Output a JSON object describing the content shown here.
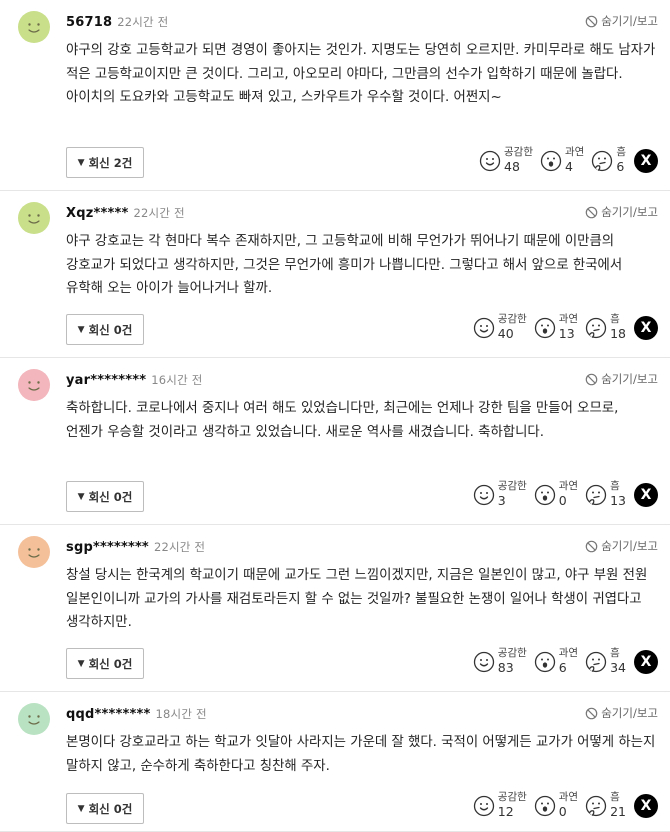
{
  "ui": {
    "hide_label": "숨기기/보고",
    "reply_suffix": "회신",
    "react_empathy": "공감한",
    "react_surprise": "과연",
    "react_hmm": "흠",
    "x_label": "X"
  },
  "comments": [
    {
      "user": "56718",
      "time": "22시간 전",
      "avatar_color": "#c9df8a",
      "body": "야구의 강호 고등학교가 되면 경영이 좋아지는 것인가. 지명도는 당연히 오르지만. 카미무라로 해도 남자가 적은 고등학교이지만 큰 것이다. 그리고, 아오모리 야마다, 그만큼의 선수가 입학하기 때문에 놀랍다. 아이치의 도요카와 고등학교도 빠져 있고, 스카우트가 우수할 것이다. 어쩐지~",
      "reply_label": "회신 2건",
      "empathy": "48",
      "surprise": "4",
      "hmm": "6"
    },
    {
      "user": "Xqz*****",
      "time": "22시간 전",
      "avatar_color": "#c9df8a",
      "body": "야구 강호교는 각 현마다 복수 존재하지만, 그 고등학교에 비해 무언가가 뛰어나기 때문에 이만큼의 강호교가 되었다고 생각하지만, 그것은 무언가에 흥미가 나쁩니다만. 그렇다고 해서 앞으로 한국에서 유학해 오는 아이가 늘어나거나 할까.",
      "reply_label": "회신 0건",
      "empathy": "40",
      "surprise": "13",
      "hmm": "18"
    },
    {
      "user": "yar********",
      "time": "16시간 전",
      "avatar_color": "#f2b6bc",
      "body": "축하합니다. 코로나에서 중지나 여러 해도 있었습니다만, 최근에는 언제나 강한 팀을 만들어 오므로, 언젠가 우승할 것이라고 생각하고 있었습니다. 새로운 역사를 새겼습니다. 축하합니다.",
      "reply_label": "회신 0건",
      "empathy": "3",
      "surprise": "0",
      "hmm": "13"
    },
    {
      "user": "sgp********",
      "time": "22시간 전",
      "avatar_color": "#f4c09a",
      "body": "창설 당시는 한국계의 학교이기 때문에 교가도 그런 느낌이겠지만, 지금은 일본인이 많고, 야구 부원 전원 일본인이니까 교가의 가사를 재검토라든지 할 수 없는 것일까? 불필요한 논쟁이 일어나 학생이 귀엽다고 생각하지만.",
      "reply_label": "회신 0건",
      "empathy": "83",
      "surprise": "6",
      "hmm": "34"
    },
    {
      "user": "qqd********",
      "time": "18시간 전",
      "avatar_color": "#b9e2c2",
      "body": "본명이다 강호교라고 하는 학교가 잇달아 사라지는 가운데 잘 했다. 국적이 어떻게든 교가가 어떻게 하는지 말하지 않고, 순수하게 축하한다고 칭찬해 주자.",
      "reply_label": "회신 0건",
      "empathy": "12",
      "surprise": "0",
      "hmm": "21"
    }
  ]
}
